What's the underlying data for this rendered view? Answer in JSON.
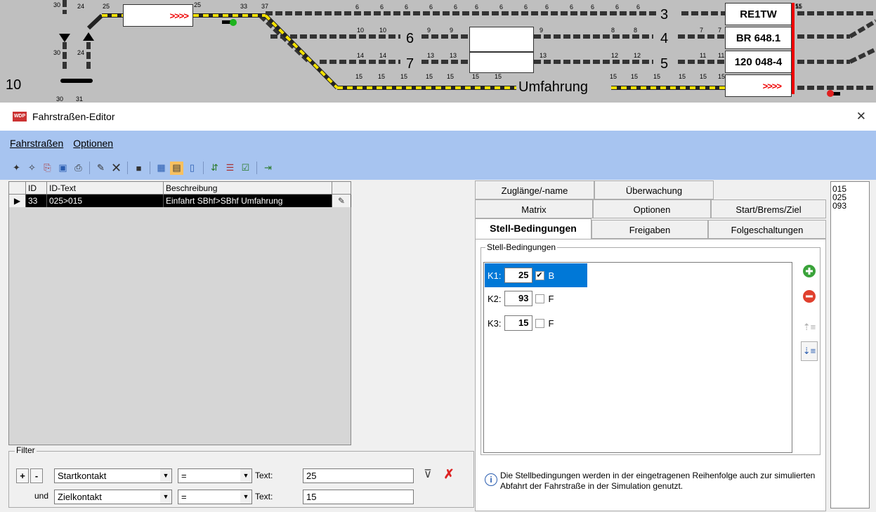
{
  "track": {
    "left_labels": [
      "30",
      "24",
      "25"
    ],
    "top_label_25b": "25",
    "top_labels_33": [
      "33",
      "37"
    ],
    "row1_nums": [
      "6",
      "6",
      "6",
      "6",
      "6",
      "6",
      "6",
      "6",
      "6",
      "6",
      "6",
      "6",
      "6",
      "6",
      "6",
      "6"
    ],
    "row2_nums": [
      "10",
      "10",
      "9",
      "9",
      "9",
      "8",
      "8",
      "7",
      "7"
    ],
    "row3_nums": [
      "14",
      "14",
      "13",
      "13",
      "13",
      "12",
      "12",
      "11",
      "11"
    ],
    "row4_nums": [
      "15",
      "15",
      "15",
      "15",
      "15",
      "15",
      "15",
      "15",
      "15",
      "15",
      "15",
      "15",
      "15"
    ],
    "track_numbers": {
      "t3": "3",
      "t4": "4",
      "t5": "5",
      "t6": "6",
      "t7": "7",
      "t10": "10"
    },
    "umfahrung": "Umfahrung",
    "arrows_top": ">>>>",
    "arrows_bottom": ">>>>",
    "train_label_1": "RE1TW",
    "train_label_2": "BR 648.1",
    "train_label_3": "120 048-4",
    "bottom_nums": [
      "30",
      "31"
    ],
    "side_nums": [
      "30",
      "24"
    ],
    "right_nums": [
      "5",
      "11",
      "15"
    ]
  },
  "window": {
    "title": "Fahrstraßen-Editor",
    "close": "✕",
    "icon_text": "WDP"
  },
  "menu": {
    "item1": "Fahrstraßen",
    "item2": "Optionen"
  },
  "toolbar": {
    "icons": [
      "new-icon",
      "new-wizard-icon",
      "copy-icon",
      "save-icon",
      "print-icon",
      "rename-icon",
      "delete-icon",
      "block-icon",
      "table-icon",
      "table-split-icon",
      "table-vertical-icon",
      "route-icon",
      "route-list-icon",
      "check-icon",
      "exit-icon"
    ]
  },
  "grid": {
    "columns": [
      "ID",
      "ID-Text",
      "Beschreibung",
      ""
    ],
    "rows": [
      {
        "id": "33",
        "id_text": "025>015",
        "description": "Einfahrt SBhf>SBhf Umfahrung"
      }
    ]
  },
  "filter": {
    "legend": "Filter",
    "plus": "+",
    "minus": "-",
    "und": "und",
    "field1": "Startkontakt",
    "op1": "=",
    "text_label1": "Text:",
    "value1": "25",
    "field2": "Zielkontakt",
    "op2": "=",
    "text_label2": "Text:",
    "value2": "15"
  },
  "tabs": {
    "row1": [
      "Zuglänge/-name",
      "Überwachung"
    ],
    "row2": [
      "Matrix",
      "Optionen",
      "Start/Brems/Ziel"
    ],
    "row3": [
      "Stell-Bedingungen",
      "Freigaben",
      "Folgeschaltungen"
    ]
  },
  "stell": {
    "legend": "Stell-Bedingungen",
    "conditions": [
      {
        "label": "K1:",
        "value": "25",
        "checked": "✔",
        "flag": "B"
      },
      {
        "label": "K2:",
        "value": "93",
        "checked": "",
        "flag": "F"
      },
      {
        "label": "K3:",
        "value": "15",
        "checked": "",
        "flag": "F"
      }
    ]
  },
  "info": {
    "text": "Die Stellbedingungen werden in der eingetragenen Reihenfolge auch zur simulierten Abfahrt der Fahrstraße in der Simulation genutzt."
  },
  "rightlist": {
    "items": [
      "015",
      "025",
      "093"
    ]
  },
  "colors": {
    "menubar": "#a7c4f0",
    "selection": "#0078d7",
    "track": "#bfbfbf"
  }
}
